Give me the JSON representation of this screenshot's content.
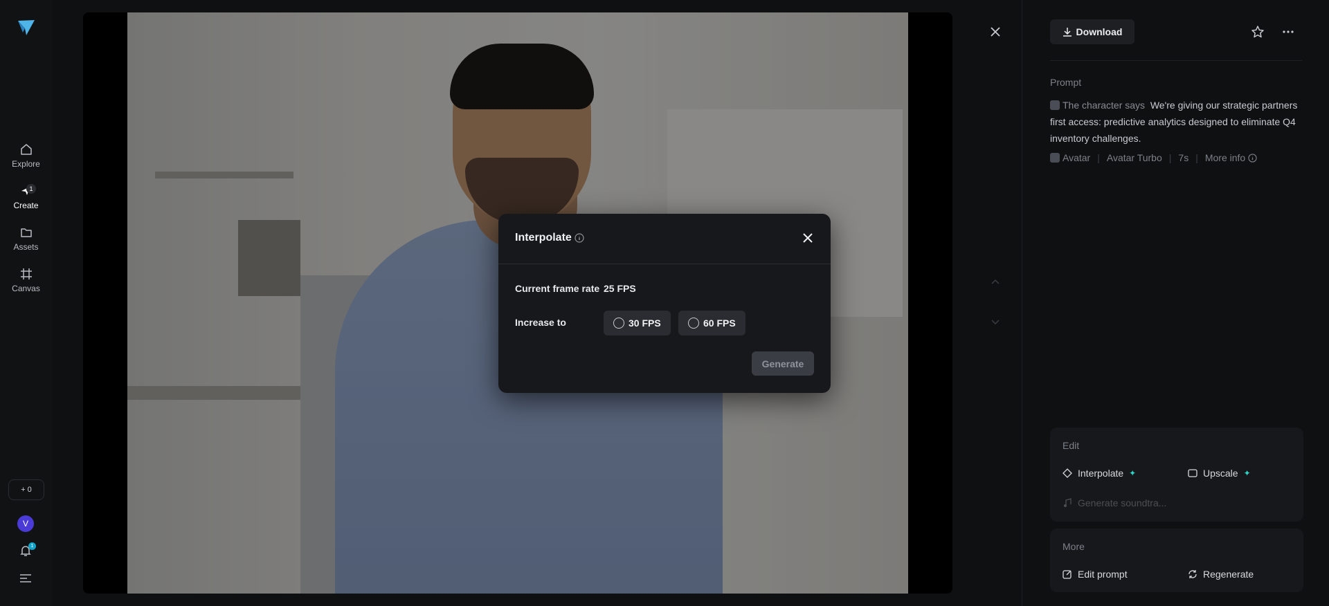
{
  "sidebar": {
    "items": [
      {
        "label": "Explore",
        "icon": "home-icon"
      },
      {
        "label": "Create",
        "icon": "create-icon",
        "badge": "1"
      },
      {
        "label": "Assets",
        "icon": "folder-icon"
      },
      {
        "label": "Canvas",
        "icon": "canvas-icon"
      }
    ],
    "credits": "+ 0",
    "avatar_initial": "V",
    "notification_count": "1"
  },
  "panel": {
    "download_label": "Download",
    "prompt_label": "Prompt",
    "prompt_prefix": "The character says",
    "prompt_text": "We're giving our strategic partners first access: predictive analytics designed to eliminate Q4 inventory challenges.",
    "meta": {
      "type": "Avatar",
      "model": "Avatar Turbo",
      "duration": "7s",
      "more_info": "More info"
    },
    "edit": {
      "title": "Edit",
      "interpolate": "Interpolate",
      "upscale": "Upscale",
      "soundtrack": "Generate soundtra..."
    },
    "more": {
      "title": "More",
      "edit_prompt": "Edit prompt",
      "regenerate": "Regenerate"
    }
  },
  "modal": {
    "title": "Interpolate",
    "current_frame_rate_label": "Current frame rate",
    "current_frame_rate_value": "25 FPS",
    "increase_to_label": "Increase to",
    "option_30": "30 FPS",
    "option_60": "60 FPS",
    "generate_label": "Generate"
  },
  "colors": {
    "accent_spark": "#2cd5c4",
    "avatar_bg": "#4b3bd6",
    "notification_bg": "#11a3c9"
  }
}
